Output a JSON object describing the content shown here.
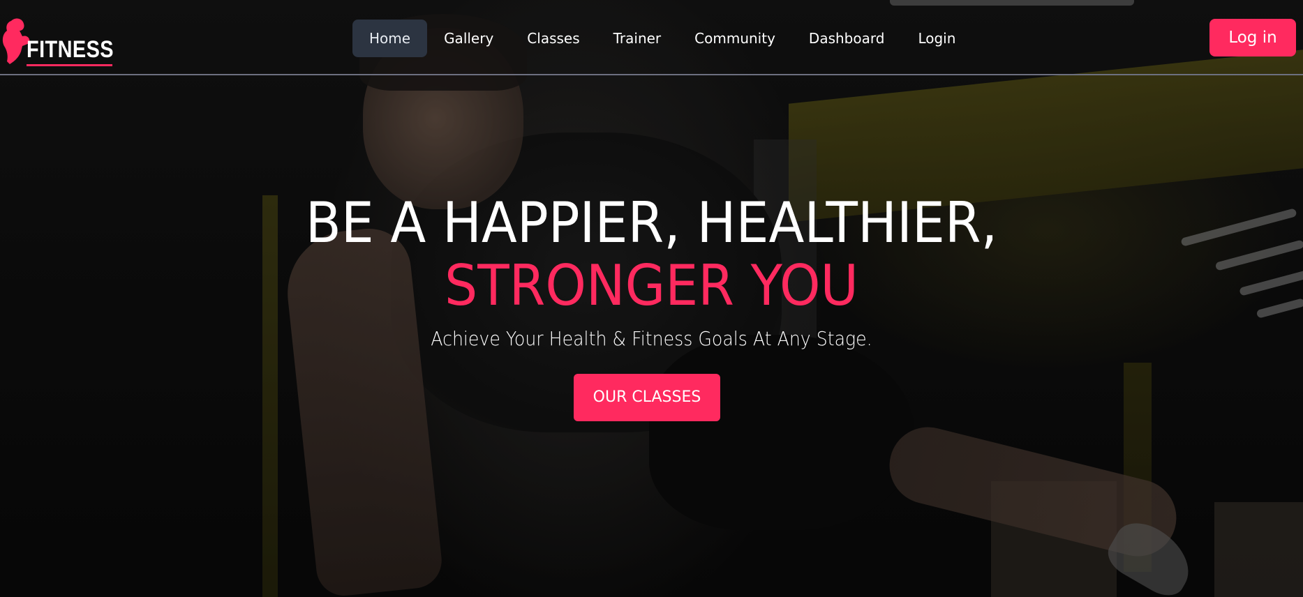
{
  "brand": {
    "name": "FITNESS",
    "accent_color": "#ff2a5f",
    "logo_icon": "flexing-bodybuilder-icon"
  },
  "nav": {
    "items": [
      {
        "label": "Home",
        "active": true
      },
      {
        "label": "Gallery",
        "active": false
      },
      {
        "label": "Classes",
        "active": false
      },
      {
        "label": "Trainer",
        "active": false
      },
      {
        "label": "Community",
        "active": false
      },
      {
        "label": "Dashboard",
        "active": false
      },
      {
        "label": "Login",
        "active": false
      }
    ],
    "active_bg_color": "#2c3441"
  },
  "header": {
    "login_button_label": "Log in"
  },
  "hero": {
    "headline_line1": "BE A HAPPIER, HEALTHIER,",
    "headline_line2": "STRONGER YOU",
    "subtitle": "Achieve Your Health & Fitness Goals At Any Stage.",
    "cta_label": "OUR CLASSES",
    "background_image": "gym-athlete-one-arm-plank-photo"
  }
}
